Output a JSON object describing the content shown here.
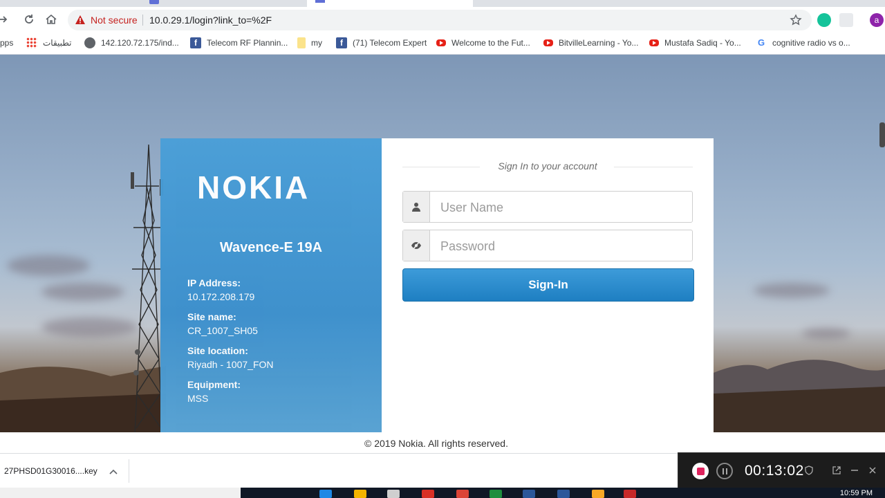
{
  "browser": {
    "not_secure": "Not secure",
    "url": "10.0.29.1/login?link_to=%2F",
    "profile_initial": "a"
  },
  "bookmarks": [
    {
      "label": "pps",
      "icon": "none"
    },
    {
      "label": "تطبيقات",
      "icon": "apps-grid-icon"
    },
    {
      "label": "142.120.72.175/ind...",
      "icon": "globe-icon"
    },
    {
      "label": "Telecom RF Plannin...",
      "icon": "facebook-icon"
    },
    {
      "label": "my",
      "icon": "folder-icon"
    },
    {
      "label": "(71) Telecom Expert",
      "icon": "facebook-icon"
    },
    {
      "label": "Welcome to the Fut...",
      "icon": "youtube-icon"
    },
    {
      "label": "BitvilleLearning - Yo...",
      "icon": "youtube-icon"
    },
    {
      "label": "Mustafa Sadiq - Yo...",
      "icon": "youtube-icon"
    },
    {
      "label": "cognitive radio vs o...",
      "icon": "google-icon"
    }
  ],
  "login": {
    "brand": "NOKIA",
    "product": "Wavence-E  19A",
    "ip_label": "IP Address:",
    "ip_value": "10.172.208.179",
    "site_name_label": "Site name:",
    "site_name_value": "CR_1007_SH05",
    "site_location_label": "Site location:",
    "site_location_value": "Riyadh - 1007_FON",
    "equipment_label": "Equipment:",
    "equipment_value": "MSS",
    "signin_heading": "Sign In to your account",
    "username_placeholder": "User Name",
    "password_placeholder": "Password",
    "signin_button": "Sign-In",
    "copyright": "© 2019 Nokia. All rights reserved."
  },
  "download": {
    "filename": "27PHSD01G30016....key"
  },
  "recorder": {
    "elapsed": "00:13:02"
  },
  "taskbar": {
    "clock": "10:59 PM"
  },
  "colors": {
    "panel_blue": "#3b8fcc",
    "button_blue": "#1e7fc2",
    "not_secure_red": "#c5221f"
  }
}
